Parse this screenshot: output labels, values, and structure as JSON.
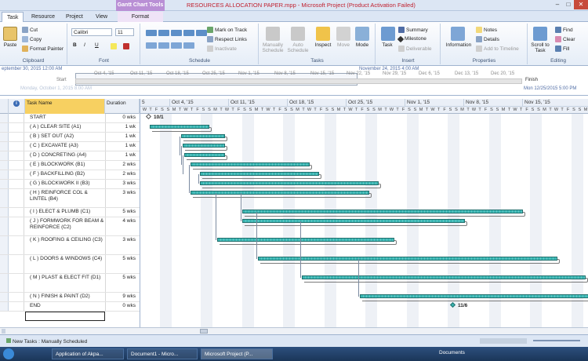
{
  "window": {
    "context_tab": "Gantt Chart Tools",
    "title": "RESOURCES ALLOCATION PAPER.mpp - Microsoft Project (Product Activation Failed)"
  },
  "tabs": [
    "Task",
    "Resource",
    "Project",
    "View",
    "Format"
  ],
  "ribbon": {
    "clipboard": {
      "paste": "Paste",
      "cut": "Cut",
      "copy": "Copy",
      "format_painter": "Format Painter",
      "label": "Clipboard"
    },
    "font": {
      "family": "Calibri",
      "size": "11",
      "bold": "B",
      "italic": "I",
      "underline": "U",
      "label": "Font"
    },
    "schedule": {
      "mark_on_track": "Mark on Track",
      "respect_links": "Respect Links",
      "inactivate": "Inactivate",
      "label": "Schedule"
    },
    "tasks": {
      "manually": "Manually Schedule",
      "auto": "Auto Schedule",
      "inspect": "Inspect",
      "move": "Move",
      "mode": "Mode",
      "label": "Tasks"
    },
    "insert": {
      "task": "Task",
      "summary": "Summary",
      "milestone": "Milestone",
      "deliverable": "Deliverable",
      "label": "Insert"
    },
    "properties": {
      "information": "Information",
      "notes": "Notes",
      "details": "Details",
      "add_to_timeline": "Add to Timeline",
      "label": "Properties"
    },
    "editing": {
      "scroll_to_task": "Scroll to Task",
      "find": "Find",
      "clear": "Clear",
      "fill": "Fill",
      "label": "Editing"
    }
  },
  "timeline": {
    "left_date": "eptember 30, 2015 12:00 AM",
    "right_date": "November 24, 2015 4:00 AM",
    "start_label": "Start",
    "finish_label": "Finish",
    "start_sub": "Monday, October 1, 2015 8:00 AM",
    "finish_sub": "Mon 12/25/2015 5:00 PM",
    "ticks": [
      "Oct 4, '15",
      "Oct 11, '15",
      "Oct 18, '15",
      "Oct 25, '15",
      "Nov 1, '15",
      "Nov 8, '15",
      "Nov 15, '15",
      "Nov 22, '15",
      "Nov 29, '15",
      "Dec 6, '15",
      "Dec 13, '15",
      "Dec 20, '15"
    ]
  },
  "table": {
    "col_task": "Task Name",
    "col_duration": "Duration",
    "rows": [
      {
        "name": "START",
        "duration": "0 wks"
      },
      {
        "name": "( A ) CLEAR SITE (A1)",
        "duration": "1 wk"
      },
      {
        "name": "( B ) SET OUT (A2)",
        "duration": "1 wk"
      },
      {
        "name": "( C ) EXCAVATE (A3)",
        "duration": "1 wk"
      },
      {
        "name": "( D ) CONCRETING (A4)",
        "duration": "1 wk"
      },
      {
        "name": "( E ) BLOCKWORK (B1)",
        "duration": "2 wks"
      },
      {
        "name": "( F ) BACKFILLING (B2)",
        "duration": "2 wks"
      },
      {
        "name": "( G ) BLOCKWORK II (B3)",
        "duration": "3 wks"
      },
      {
        "name": "( H ) REINFORCE COL & LINTEL (B4)",
        "duration": "3 wks"
      },
      {
        "name": "( I ) ELECT & PLUMB (C1)",
        "duration": "5 wks"
      },
      {
        "name": "( J ) FORMWORK FOR BEAM & REINFORCE (C2)",
        "duration": "4 wks"
      },
      {
        "name": "( K ) ROOFING & CEILING (C3)",
        "duration": "3 wks"
      },
      {
        "name": "( L ) DOORS & WINDOWS (C4)",
        "duration": "5 wks"
      },
      {
        "name": "( M ) PLAST & ELECT FIT (D1)",
        "duration": "5 wks"
      },
      {
        "name": "( N ) FINISH & PAINT (D2)",
        "duration": "9 wks"
      },
      {
        "name": "END",
        "duration": "0 wks"
      }
    ]
  },
  "gantt": {
    "weeks": [
      "5",
      "Oct 4, '15",
      "Oct 11, '15",
      "Oct 18, '15",
      "Oct 25, '15",
      "Nov 1, '15",
      "Nov 8, '15",
      "Nov 15, '15"
    ],
    "days": [
      "W",
      "T",
      "F",
      "S",
      "S",
      "M",
      "T",
      "W",
      "T",
      "F",
      "S",
      "S",
      "M",
      "T",
      "W",
      "T",
      "F",
      "S",
      "S",
      "M",
      "T",
      "W",
      "T",
      "F",
      "S",
      "S",
      "M",
      "T",
      "W",
      "T",
      "F",
      "S",
      "S",
      "M",
      "T",
      "W",
      "T",
      "F",
      "S",
      "S",
      "M",
      "T",
      "W",
      "T",
      "F",
      "S",
      "S",
      "M",
      "T",
      "W",
      "T",
      "F",
      "S",
      "S",
      "M",
      "T",
      "W",
      "T",
      "F",
      "S",
      "S",
      "M",
      "T",
      "W",
      "T",
      "F",
      "S",
      "S",
      "M",
      "T",
      "W",
      "T",
      "F",
      "S",
      "S",
      "M",
      "T",
      "W",
      "T"
    ],
    "start_milestone": "10/1",
    "end_milestone": "11/6"
  },
  "status": {
    "new_tasks": "New Tasks : Manually Scheduled"
  },
  "taskbar": {
    "items": [
      "Application of Akpa...",
      "Document1 - Micro...",
      "Microsoft Project (P..."
    ],
    "tray_label": "Documents"
  }
}
